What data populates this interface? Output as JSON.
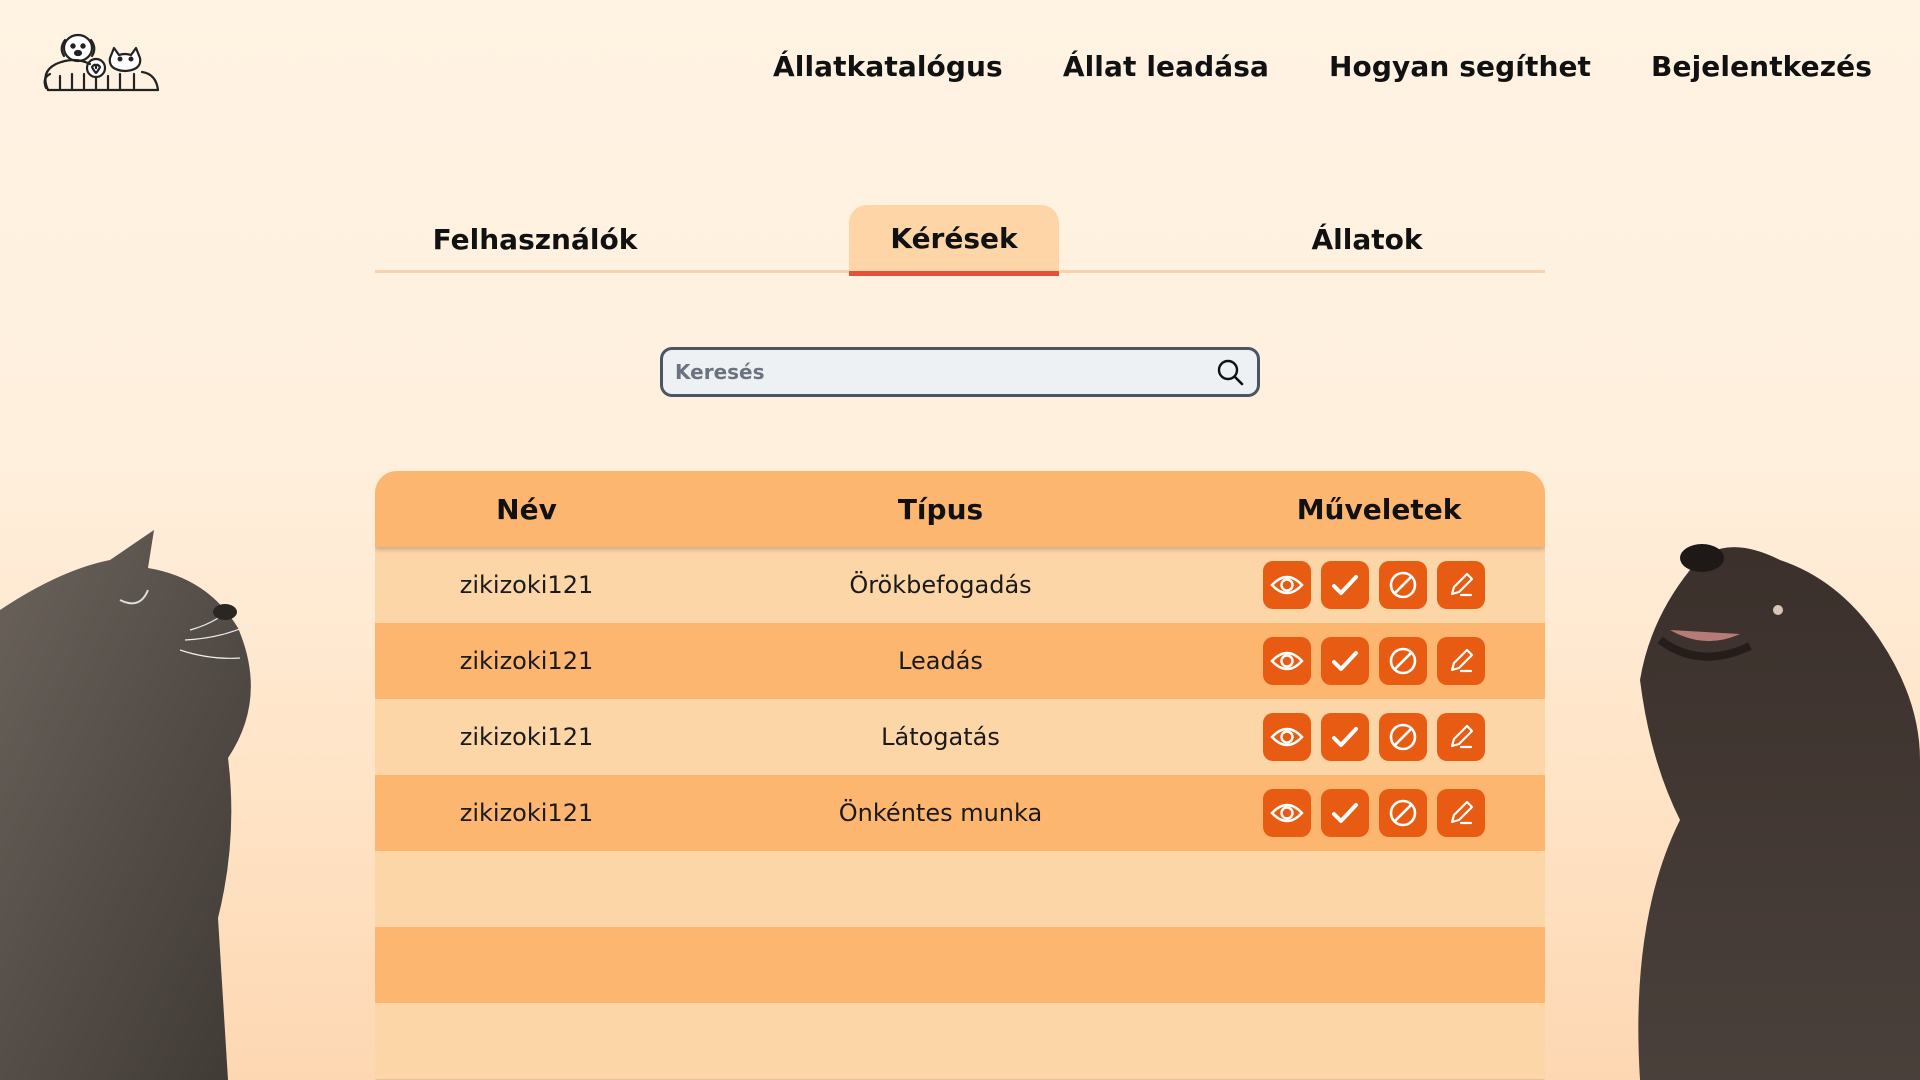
{
  "nav": {
    "items": [
      "Állatkatalógus",
      "Állat leadása",
      "Hogyan segíthet",
      "Bejelentkezés"
    ]
  },
  "tabs": {
    "users": "Felhasználók",
    "requests": "Kérések",
    "animals": "Állatok",
    "active": "Kérések"
  },
  "search": {
    "placeholder": "Keresés",
    "value": ""
  },
  "table": {
    "headers": [
      "Név",
      "Típus",
      "Műveletek"
    ],
    "rows": [
      {
        "name": "zikizoki121",
        "type": "Örökbefogadás"
      },
      {
        "name": "zikizoki121",
        "type": "Leadás"
      },
      {
        "name": "zikizoki121",
        "type": "Látogatás"
      },
      {
        "name": "zikizoki121",
        "type": "Önkéntes munka"
      }
    ],
    "actions": [
      "eye-icon",
      "check-icon",
      "ban-icon",
      "pencil-icon"
    ]
  },
  "colors": {
    "accent": "#e85b12",
    "header_row": "#fdb670",
    "light_row": "#fdd6a8",
    "tab_underline": "#e2513a"
  }
}
